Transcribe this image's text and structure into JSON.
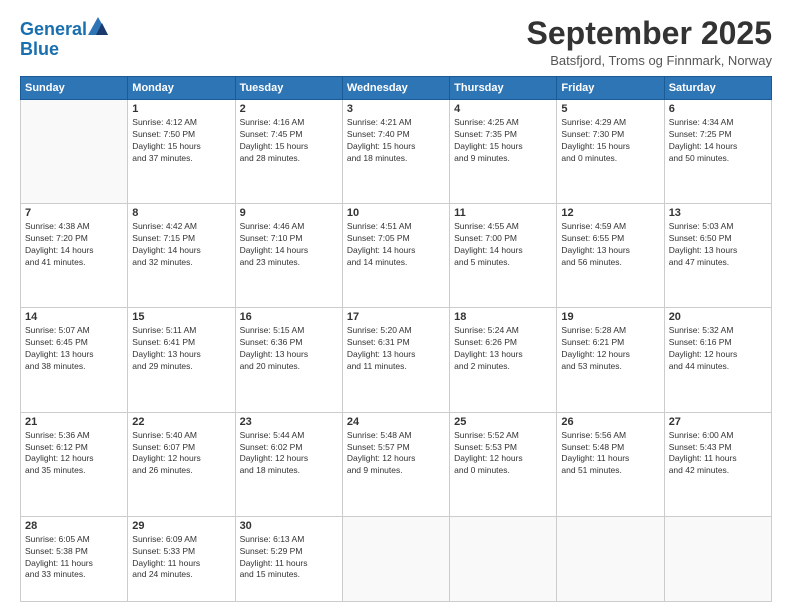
{
  "header": {
    "logo_line1": "General",
    "logo_line2": "Blue",
    "month": "September 2025",
    "location": "Batsfjord, Troms og Finnmark, Norway"
  },
  "weekdays": [
    "Sunday",
    "Monday",
    "Tuesday",
    "Wednesday",
    "Thursday",
    "Friday",
    "Saturday"
  ],
  "weeks": [
    [
      {
        "day": "",
        "info": ""
      },
      {
        "day": "1",
        "info": "Sunrise: 4:12 AM\nSunset: 7:50 PM\nDaylight: 15 hours\nand 37 minutes."
      },
      {
        "day": "2",
        "info": "Sunrise: 4:16 AM\nSunset: 7:45 PM\nDaylight: 15 hours\nand 28 minutes."
      },
      {
        "day": "3",
        "info": "Sunrise: 4:21 AM\nSunset: 7:40 PM\nDaylight: 15 hours\nand 18 minutes."
      },
      {
        "day": "4",
        "info": "Sunrise: 4:25 AM\nSunset: 7:35 PM\nDaylight: 15 hours\nand 9 minutes."
      },
      {
        "day": "5",
        "info": "Sunrise: 4:29 AM\nSunset: 7:30 PM\nDaylight: 15 hours\nand 0 minutes."
      },
      {
        "day": "6",
        "info": "Sunrise: 4:34 AM\nSunset: 7:25 PM\nDaylight: 14 hours\nand 50 minutes."
      }
    ],
    [
      {
        "day": "7",
        "info": "Sunrise: 4:38 AM\nSunset: 7:20 PM\nDaylight: 14 hours\nand 41 minutes."
      },
      {
        "day": "8",
        "info": "Sunrise: 4:42 AM\nSunset: 7:15 PM\nDaylight: 14 hours\nand 32 minutes."
      },
      {
        "day": "9",
        "info": "Sunrise: 4:46 AM\nSunset: 7:10 PM\nDaylight: 14 hours\nand 23 minutes."
      },
      {
        "day": "10",
        "info": "Sunrise: 4:51 AM\nSunset: 7:05 PM\nDaylight: 14 hours\nand 14 minutes."
      },
      {
        "day": "11",
        "info": "Sunrise: 4:55 AM\nSunset: 7:00 PM\nDaylight: 14 hours\nand 5 minutes."
      },
      {
        "day": "12",
        "info": "Sunrise: 4:59 AM\nSunset: 6:55 PM\nDaylight: 13 hours\nand 56 minutes."
      },
      {
        "day": "13",
        "info": "Sunrise: 5:03 AM\nSunset: 6:50 PM\nDaylight: 13 hours\nand 47 minutes."
      }
    ],
    [
      {
        "day": "14",
        "info": "Sunrise: 5:07 AM\nSunset: 6:45 PM\nDaylight: 13 hours\nand 38 minutes."
      },
      {
        "day": "15",
        "info": "Sunrise: 5:11 AM\nSunset: 6:41 PM\nDaylight: 13 hours\nand 29 minutes."
      },
      {
        "day": "16",
        "info": "Sunrise: 5:15 AM\nSunset: 6:36 PM\nDaylight: 13 hours\nand 20 minutes."
      },
      {
        "day": "17",
        "info": "Sunrise: 5:20 AM\nSunset: 6:31 PM\nDaylight: 13 hours\nand 11 minutes."
      },
      {
        "day": "18",
        "info": "Sunrise: 5:24 AM\nSunset: 6:26 PM\nDaylight: 13 hours\nand 2 minutes."
      },
      {
        "day": "19",
        "info": "Sunrise: 5:28 AM\nSunset: 6:21 PM\nDaylight: 12 hours\nand 53 minutes."
      },
      {
        "day": "20",
        "info": "Sunrise: 5:32 AM\nSunset: 6:16 PM\nDaylight: 12 hours\nand 44 minutes."
      }
    ],
    [
      {
        "day": "21",
        "info": "Sunrise: 5:36 AM\nSunset: 6:12 PM\nDaylight: 12 hours\nand 35 minutes."
      },
      {
        "day": "22",
        "info": "Sunrise: 5:40 AM\nSunset: 6:07 PM\nDaylight: 12 hours\nand 26 minutes."
      },
      {
        "day": "23",
        "info": "Sunrise: 5:44 AM\nSunset: 6:02 PM\nDaylight: 12 hours\nand 18 minutes."
      },
      {
        "day": "24",
        "info": "Sunrise: 5:48 AM\nSunset: 5:57 PM\nDaylight: 12 hours\nand 9 minutes."
      },
      {
        "day": "25",
        "info": "Sunrise: 5:52 AM\nSunset: 5:53 PM\nDaylight: 12 hours\nand 0 minutes."
      },
      {
        "day": "26",
        "info": "Sunrise: 5:56 AM\nSunset: 5:48 PM\nDaylight: 11 hours\nand 51 minutes."
      },
      {
        "day": "27",
        "info": "Sunrise: 6:00 AM\nSunset: 5:43 PM\nDaylight: 11 hours\nand 42 minutes."
      }
    ],
    [
      {
        "day": "28",
        "info": "Sunrise: 6:05 AM\nSunset: 5:38 PM\nDaylight: 11 hours\nand 33 minutes."
      },
      {
        "day": "29",
        "info": "Sunrise: 6:09 AM\nSunset: 5:33 PM\nDaylight: 11 hours\nand 24 minutes."
      },
      {
        "day": "30",
        "info": "Sunrise: 6:13 AM\nSunset: 5:29 PM\nDaylight: 11 hours\nand 15 minutes."
      },
      {
        "day": "",
        "info": ""
      },
      {
        "day": "",
        "info": ""
      },
      {
        "day": "",
        "info": ""
      },
      {
        "day": "",
        "info": ""
      }
    ]
  ]
}
